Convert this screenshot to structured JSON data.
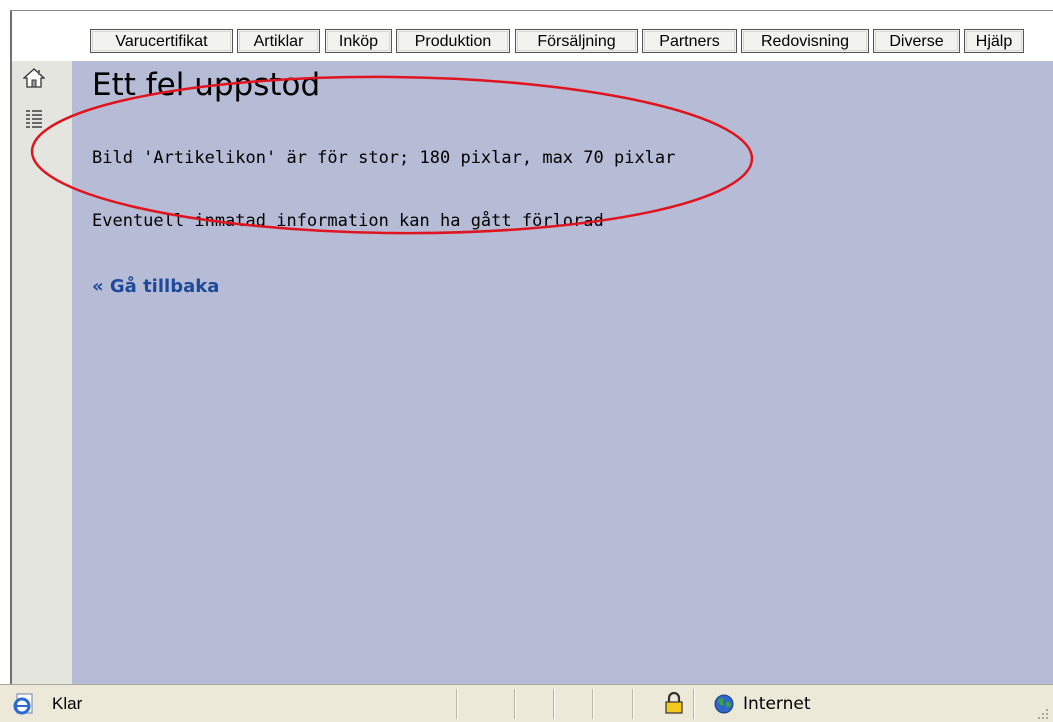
{
  "nav": {
    "tabs": [
      {
        "label": "Varucertifikat"
      },
      {
        "label": "Artiklar"
      },
      {
        "label": "Inköp"
      },
      {
        "label": "Produktion"
      },
      {
        "label": "Försäljning"
      },
      {
        "label": "Partners"
      },
      {
        "label": "Redovisning"
      },
      {
        "label": "Diverse"
      },
      {
        "label": "Hjälp"
      }
    ]
  },
  "sidebar": {
    "icons": [
      "home-icon",
      "list-icon"
    ]
  },
  "main": {
    "title": "Ett fel uppstod",
    "error_message": "Bild 'Artikelikon' är för stor; 180 pixlar, max 70 pixlar",
    "info_message": "Eventuell inmatad information kan ha gått förlorad",
    "back_link": "« Gå tillbaka"
  },
  "annotation": {
    "color": "#e0141e"
  },
  "statusbar": {
    "status": "Klar",
    "zone": "Internet"
  },
  "colors": {
    "content_bg": "#b6bcd6",
    "sidebar_bg": "#e5e5df",
    "link": "#1f4a9a",
    "statusbar_bg": "#ece9d8"
  }
}
